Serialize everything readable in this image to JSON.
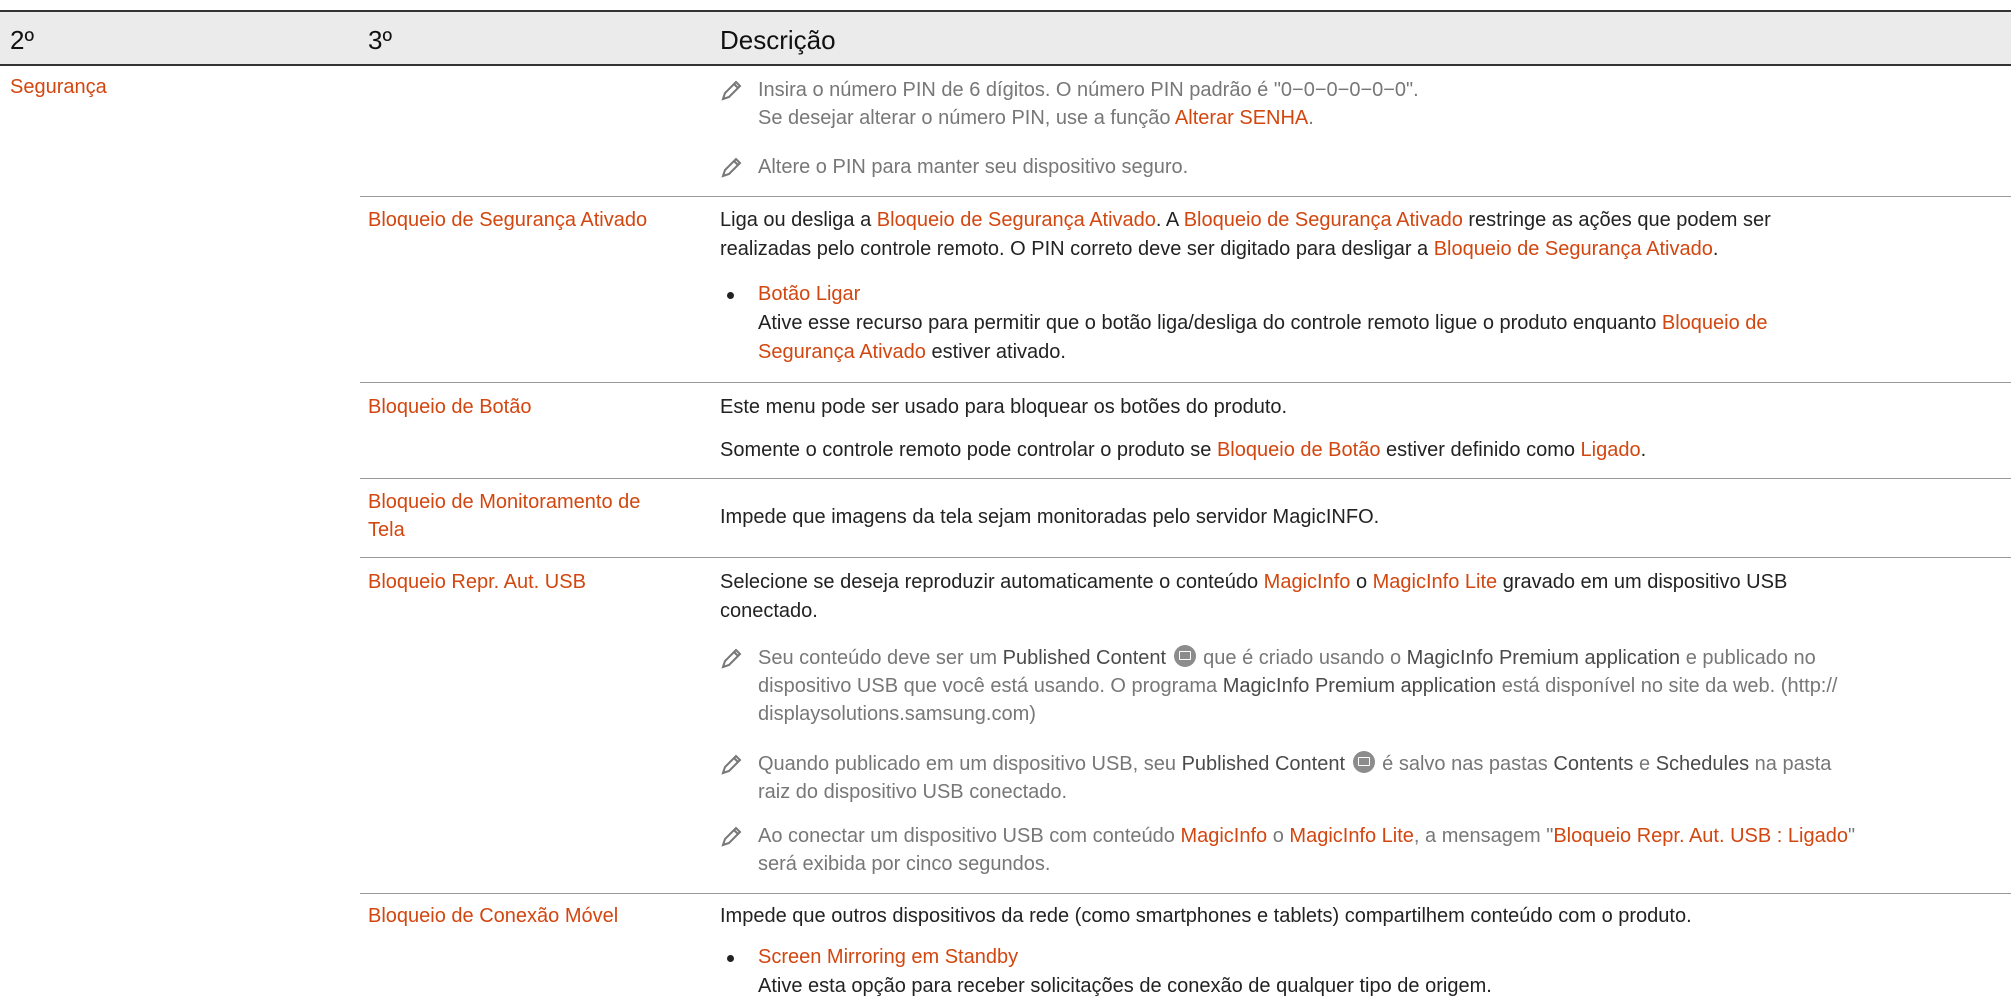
{
  "header": {
    "col2": "2º",
    "col3": "3º",
    "col4": "Descrição"
  },
  "colors": {
    "accent": "#d2460f",
    "header_bg": "#ebebeb"
  },
  "section": "Segurança",
  "pin_notes": {
    "n1a": "Insira o número PIN de 6 dígitos. O número PIN padrão é \"0−0−0−0−0−0\".",
    "n1b_pre": "Se desejar alterar o número PIN, use a função ",
    "n1b_link": "Alterar SENHA",
    "n1b_post": ".",
    "n2": "Altere o PIN para manter seu dispositivo seguro."
  },
  "r1": {
    "name": "Bloqueio de Segurança Ativado",
    "d1": "Liga ou desliga a ",
    "h1": "Bloqueio de Segurança Ativado",
    "d2": ". A ",
    "h2": "Bloqueio de Segurança Ativado",
    "d3": " restringe as ações que podem ser",
    "d4": "realizadas pelo controle remoto. O PIN correto deve ser digitado para desligar a ",
    "h3": "Bloqueio de Segurança Ativado",
    "d5": ".",
    "bullet_title": "Botão Ligar",
    "b1": "Ative esse recurso para permitir que o botão liga/desliga do controle remoto ligue o produto enquanto ",
    "b_h1": "Bloqueio de",
    "b_h2": "Segurança Ativado",
    "b2": " estiver ativado."
  },
  "r2": {
    "name": "Bloqueio de Botão",
    "d1": "Este menu pode ser usado para bloquear os botões do produto.",
    "d2a": "Somente o controle remoto pode controlar o produto se ",
    "d2h": "Bloqueio de Botão",
    "d2b": " estiver definido como ",
    "d2h2": "Ligado",
    "d2c": "."
  },
  "r3": {
    "name_l1": "Bloqueio de Monitoramento de",
    "name_l2": "Tela",
    "d1": "Impede que imagens da tela sejam monitoradas pelo servidor MagicINFO."
  },
  "r4": {
    "name": "Bloqueio Repr. Aut. USB",
    "d1a": "Selecione se deseja reproduzir automaticamente o conteúdo ",
    "d1h1": "MagicInfo",
    "d1b": " o ",
    "d1h2": "MagicInfo Lite",
    "d1c": " gravado em um dispositivo USB",
    "d1d": "conectado.",
    "n1a": "Seu conteúdo deve ser um ",
    "n1b": "Published Content",
    "n1c": " que é criado usando o ",
    "n1d": "MagicInfo Premium application",
    "n1e": " e publicado no",
    "n1f": "dispositivo USB que você está usando. O programa ",
    "n1g": "MagicInfo Premium application",
    "n1h": " está disponível no site da web. (http://",
    "n1i": "displaysolutions.samsung.com)",
    "n2a": "Quando publicado em um dispositivo USB, seu ",
    "n2b": "Published Content",
    "n2c": " é salvo nas pastas ",
    "n2d": "Contents",
    "n2e": " e ",
    "n2f": "Schedules",
    "n2g": " na pasta",
    "n2h": "raiz do dispositivo USB conectado.",
    "n3a": "Ao conectar um dispositivo USB com conteúdo ",
    "n3h1": "MagicInfo",
    "n3b": " o ",
    "n3h2": "MagicInfo Lite",
    "n3c": ", a mensagem \"",
    "n3h3": "Bloqueio Repr. Aut. USB : Ligado",
    "n3d": "\"",
    "n3e": "será exibida por cinco segundos."
  },
  "r5": {
    "name": "Bloqueio de Conexão Móvel",
    "d1": "Impede que outros dispositivos da rede (como smartphones e tablets) compartilhem conteúdo com o produto.",
    "bullet_title": "Screen Mirroring em Standby",
    "b1": "Ative esta opção para receber solicitações de conexão de qualquer tipo de origem."
  }
}
